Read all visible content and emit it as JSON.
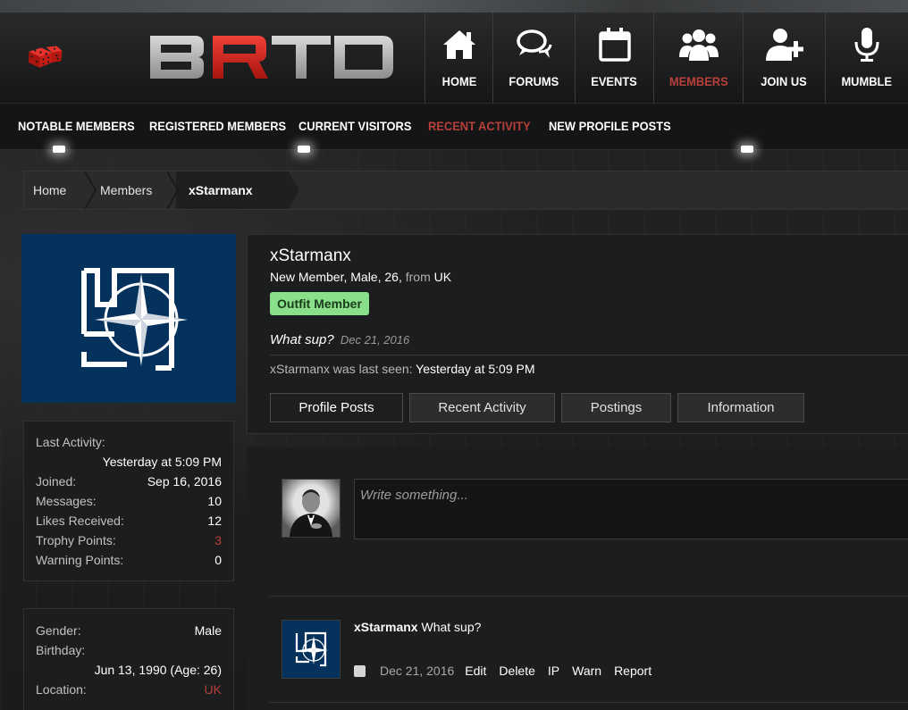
{
  "brand": {
    "logo_text": "BRTO"
  },
  "nav": [
    {
      "label": "HOME",
      "icon": "home-icon"
    },
    {
      "label": "FORUMS",
      "icon": "chat-bubbles-icon"
    },
    {
      "label": "EVENTS",
      "icon": "calendar-icon"
    },
    {
      "label": "MEMBERS",
      "icon": "group-icon",
      "active": true
    },
    {
      "label": "JOIN US",
      "icon": "user-plus-icon"
    },
    {
      "label": "MUMBLE",
      "icon": "microphone-icon"
    }
  ],
  "subnav": [
    {
      "label": "NOTABLE MEMBERS"
    },
    {
      "label": "REGISTERED MEMBERS"
    },
    {
      "label": "CURRENT VISITORS"
    },
    {
      "label": "RECENT ACTIVITY",
      "active": true
    },
    {
      "label": "NEW PROFILE POSTS"
    }
  ],
  "breadcrumb": [
    "Home",
    "Members",
    "xStarmanx"
  ],
  "stats": {
    "last_activity_label": "Last Activity:",
    "last_activity_value": "Yesterday at 5:09 PM",
    "joined_label": "Joined:",
    "joined_value": "Sep 16, 2016",
    "messages_label": "Messages:",
    "messages_value": "10",
    "likes_label": "Likes Received:",
    "likes_value": "12",
    "trophy_label": "Trophy Points:",
    "trophy_value": "3",
    "warning_label": "Warning Points:",
    "warning_value": "0"
  },
  "info": {
    "gender_label": "Gender:",
    "gender_value": "Male",
    "birthday_label": "Birthday:",
    "birthday_value": "Jun 13, 1990 (Age: 26)",
    "location_label": "Location:",
    "location_value": "UK"
  },
  "profile": {
    "name": "xStarmanx",
    "meta": "New Member, Male, 26,",
    "from_label": "from",
    "from_value": "UK",
    "badge": "Outfit Member",
    "status_text": "What sup?",
    "status_date": "Dec 21, 2016",
    "last_seen_label": "xStarmanx was last seen:",
    "last_seen_value": "Yesterday at 5:09 PM",
    "tabs": [
      "Profile Posts",
      "Recent Activity",
      "Postings",
      "Information"
    ]
  },
  "composer": {
    "placeholder": "Write something..."
  },
  "post": {
    "author": "xStarmanx",
    "text": "What sup?",
    "date": "Dec 21, 2016",
    "actions": [
      "Edit",
      "Delete",
      "IP",
      "Warn",
      "Report"
    ]
  },
  "colors": {
    "accent_red": "#b7403a",
    "badge_green": "#8ae08a",
    "avatar_blue": "#05315d"
  }
}
